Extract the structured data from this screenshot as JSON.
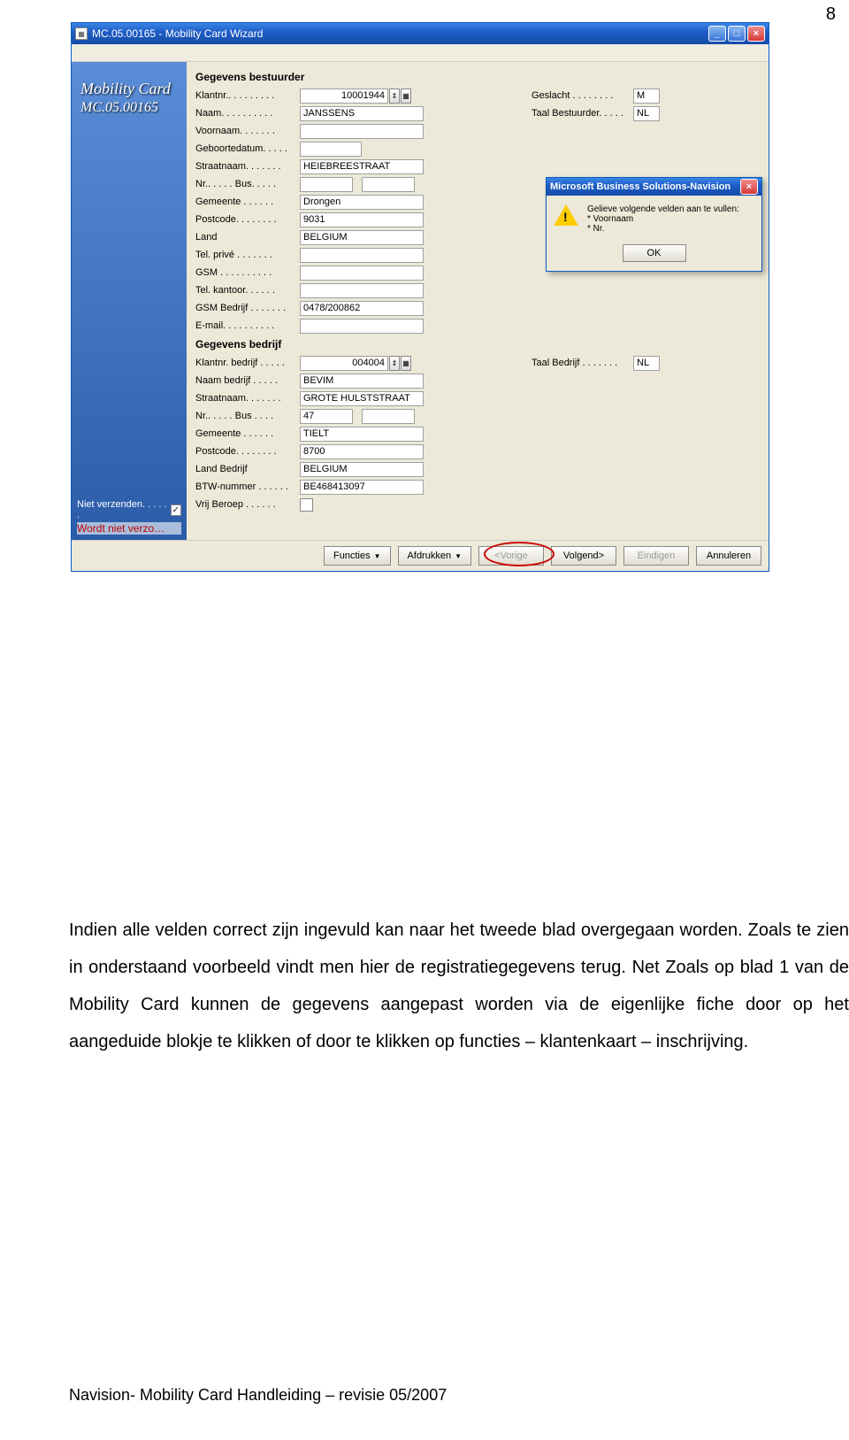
{
  "page_number": "8",
  "window": {
    "title": "MC.05.00165 - Mobility Card Wizard",
    "sidebar": {
      "line1": "Mobility Card",
      "line2": "MC.05.00165",
      "niet_verzenden": "Niet verzenden. . . . . .",
      "warn": "Wordt niet verzo…"
    },
    "driver": {
      "heading": "Gegevens bestuurder",
      "klantnr_label": "Klantnr.. . . . . . . . .",
      "klantnr": "10001944",
      "naam_label": "Naam. . . . . . . . . .",
      "naam": "JANSSENS",
      "voornaam_label": "Voornaam. . . . . . .",
      "voornaam": "",
      "geboorte_label": "Geboortedatum. . . . .",
      "geboorte": "",
      "straat_label": "Straatnaam. . . . . . .",
      "straat": "HEIEBREESTRAAT",
      "nrbus_label": "Nr.. . . . . Bus. . . . .",
      "nr": "",
      "bus": "",
      "gemeente_label": "Gemeente  . . . . . .",
      "gemeente": "Drongen",
      "postcode_label": "Postcode. . . . . . . .",
      "postcode": "9031",
      "land_label": "Land",
      "land": "BELGIUM",
      "telprive_label": "Tel. privé . . . . . . .",
      "telprive": "",
      "gsm_label": "GSM . . . . . . . . . .",
      "gsm": "",
      "telkantoor_label": "Tel. kantoor. . . . . .",
      "telkantoor": "",
      "gsmbedrijf_label": "GSM Bedrijf . . . . . . .",
      "gsmbedrijf": "0478/200862",
      "email_label": "E-mail. . . . . . . . . .",
      "email": "",
      "geslacht_label": "Geslacht . . . . . . . .",
      "geslacht": "M",
      "taal_label": "Taal Bestuurder. . . . .",
      "taal": "NL"
    },
    "company": {
      "heading": "Gegevens bedrijf",
      "klantnr_label": "Klantnr. bedrijf . . . . .",
      "klantnr": "004004",
      "naam_label": "Naam bedrijf  . . . . .",
      "naam": "BEVIM",
      "straat_label": "Straatnaam. . . . . . .",
      "straat": "GROTE HULSTSTRAAT",
      "nrbus_label": "Nr.. . . . .  Bus . . . .",
      "nr": "47",
      "bus": "",
      "gemeente_label": "Gemeente  . . . . . .",
      "gemeente": "TIELT",
      "postcode_label": "Postcode. . . . . . . .",
      "postcode": "8700",
      "land_label": "Land Bedrijf",
      "land": "BELGIUM",
      "btw_label": "BTW-nummer . . . . . .",
      "btw": "BE468413097",
      "vrijberoep_label": "Vrij Beroep . . . . . .",
      "taal_label": "Taal Bedrijf . . . . . . .",
      "taal": "NL"
    },
    "buttons": {
      "functies": "Functies",
      "afdrukken": "Afdrukken",
      "vorige": "<Vorige",
      "volgend": "Volgend>",
      "eindigen": "Eindigen",
      "annuleren": "Annuleren"
    }
  },
  "msgbox": {
    "title": "Microsoft Business Solutions-Navision",
    "line1": "Gelieve volgende velden aan te vullen:",
    "line2": "* Voornaam",
    "line3": "* Nr.",
    "ok": "OK"
  },
  "paragraph": "Indien alle velden correct zijn ingevuld kan naar het tweede blad overgegaan worden. Zoals te zien in onderstaand voorbeeld vindt men hier de registratiegegevens terug. Net Zoals op blad 1 van de Mobility Card kunnen de gegevens aangepast worden via de eigenlijke fiche door op het aangeduide blokje te klikken of door te klikken op functies – klantenkaart – inschrijving.",
  "footer": "Navision- Mobility Card Handleiding – revisie 05/2007"
}
